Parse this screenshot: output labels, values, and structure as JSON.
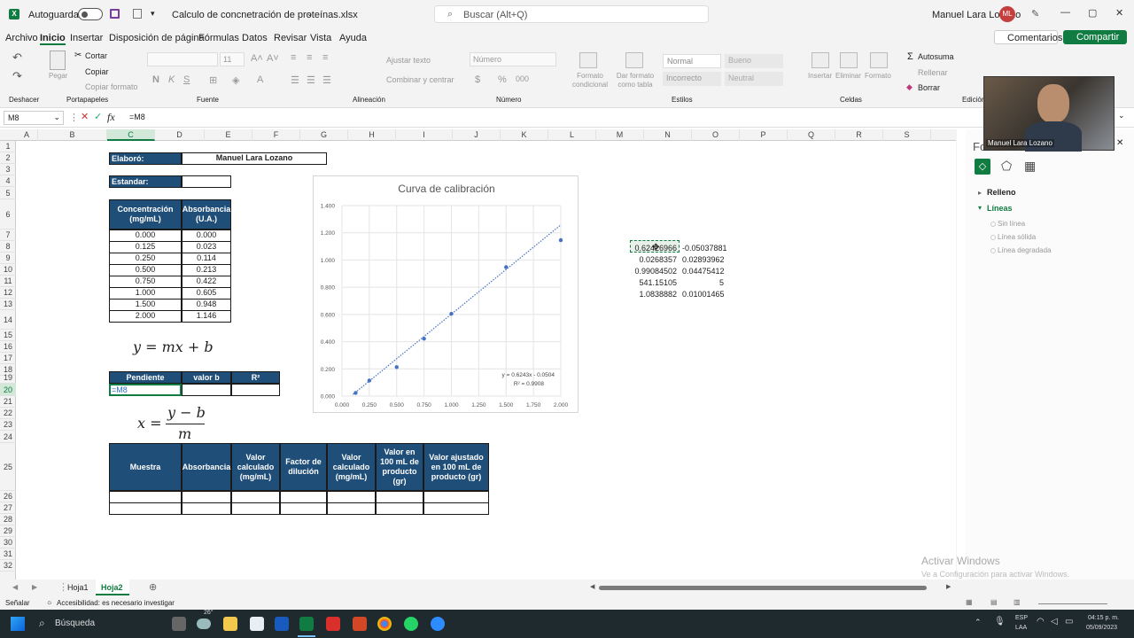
{
  "titlebar": {
    "autosave_label": "Autoguardado",
    "filename": "Calculo de concnetración de proteínas.xlsx",
    "search_placeholder": "Buscar (Alt+Q)",
    "user_name": "Manuel Lara Lozano",
    "user_initials": "ML"
  },
  "menu": {
    "items": [
      "Archivo",
      "Inicio",
      "Insertar",
      "Disposición de página",
      "Fórmulas",
      "Datos",
      "Revisar",
      "Vista",
      "Ayuda"
    ],
    "comments": "Comentarios",
    "share": "Compartir"
  },
  "ribbon": {
    "undo_group": "Deshacer",
    "clipboard": {
      "paste": "Pegar",
      "cut": "Cortar",
      "copy": "Copiar",
      "format_painter": "Copiar formato",
      "group": "Portapapeles"
    },
    "font": {
      "size": "11",
      "group": "Fuente"
    },
    "alignment": {
      "wrap": "Ajustar texto",
      "merge": "Combinar y centrar",
      "group": "Alineación"
    },
    "number": {
      "format": "Número",
      "group": "Número"
    },
    "styles": {
      "conditional": "Formato condicional",
      "as_table": "Dar formato como tabla",
      "normal": "Normal",
      "good": "Bueno",
      "bad": "Incorrecto",
      "neutral": "Neutral",
      "group": "Estilos"
    },
    "cells": {
      "insert": "Insertar",
      "delete": "Eliminar",
      "format": "Formato",
      "group": "Celdas"
    },
    "editing": {
      "autosum": "Autosuma",
      "fill": "Rellenar",
      "clear": "Borrar",
      "group": "Edición"
    }
  },
  "formula_bar": {
    "name_box": "M8",
    "fx": "fx",
    "formula": "=M8"
  },
  "columns": [
    "A",
    "B",
    "C",
    "D",
    "E",
    "F",
    "G",
    "H",
    "I",
    "J",
    "K",
    "L",
    "M",
    "N",
    "O",
    "P",
    "Q",
    "R",
    "S"
  ],
  "rows": [
    "1",
    "2",
    "3",
    "4",
    "5",
    "6",
    "7",
    "8",
    "9",
    "10",
    "11",
    "12",
    "13",
    "14",
    "15",
    "16",
    "17",
    "18",
    "19",
    "20",
    "21",
    "22",
    "23",
    "24",
    "25",
    "26",
    "27",
    "28",
    "29",
    "30",
    "31",
    "32"
  ],
  "sheet": {
    "elaboro_label": "Elaboró:",
    "elaboro_value": "Manuel Lara Lozano",
    "estandar_label": "Estandar:",
    "table_headers": {
      "conc": "Concentración (mg/mL)",
      "abs": "Absorbancia (U.A.)"
    },
    "table_rows": [
      [
        "0.000",
        "0.000"
      ],
      [
        "0.125",
        "0.023"
      ],
      [
        "0.250",
        "0.114"
      ],
      [
        "0.500",
        "0.213"
      ],
      [
        "0.750",
        "0.422"
      ],
      [
        "1.000",
        "0.605"
      ],
      [
        "1.500",
        "0.948"
      ],
      [
        "2.000",
        "1.146"
      ]
    ],
    "equation_line": "y = mx + b",
    "equation_x_lhs": "x =",
    "equation_x_num": "y − b",
    "equation_x_den": "m",
    "params_headers": [
      "Pendiente",
      "valor b",
      "R²"
    ],
    "active_cell_text": "=M8",
    "sample_headers": [
      "Muestra",
      "Absorbancia",
      "Valor calculado (mg/mL)",
      "Factor de dilución",
      "Valor calculado (mg/mL)",
      "Valor en 100 mL de producto (gr)",
      "Valor ajustado en 100 mL de producto (gr)"
    ],
    "linest": [
      [
        "0.62426966",
        "-0.05037881"
      ],
      [
        "0.0268357",
        "0.02893962"
      ],
      [
        "0.99084502",
        "0.04475412"
      ],
      [
        "541.15105",
        "5"
      ],
      [
        "1.0838882",
        "0.01001465"
      ]
    ]
  },
  "chart_data": {
    "type": "scatter",
    "title": "Curva de calibración",
    "x": [
      0.125,
      0.25,
      0.5,
      0.75,
      1.0,
      1.5,
      2.0
    ],
    "y": [
      0.023,
      0.114,
      0.213,
      0.422,
      0.605,
      0.948,
      1.146
    ],
    "xlim": [
      0,
      2
    ],
    "ylim": [
      0,
      1.4
    ],
    "xticks": [
      "0.000",
      "0.250",
      "0.500",
      "0.750",
      "1.000",
      "1.250",
      "1.500",
      "1.750",
      "2.000"
    ],
    "yticks": [
      "0.000",
      "0.200",
      "0.400",
      "0.600",
      "0.800",
      "1.000",
      "1.200",
      "1.400"
    ],
    "trendline": {
      "slope": 0.6243,
      "intercept": -0.0504,
      "equation": "y = 0.6243x - 0.0504",
      "r2": "R² = 0.9908"
    },
    "grid": true,
    "marker_color": "#4472c4"
  },
  "sidepane": {
    "title": "Fo",
    "fill": "Relleno",
    "lines": "Líneas",
    "options": [
      "Sin línea",
      "Línea sólida",
      "Línea degradada"
    ]
  },
  "webcam_name": "Manuel Lara Lozano",
  "sheet_tabs": [
    "Hoja1",
    "Hoja2"
  ],
  "status": {
    "ready": "Señalar",
    "accessibility": "Accesibilidad: es necesario investigar",
    "watermark1": "Activar Windows",
    "watermark2": "Ve a Configuración para activar Windows."
  },
  "taskbar": {
    "search": "Búsqueda",
    "weather": "26°",
    "lang1": "ESP",
    "lang2": "LAA",
    "time": "04:15 p. m.",
    "date": "05/09/2023"
  },
  "colors": {
    "excel_green": "#107c41",
    "header_blue": "#1f4e79",
    "marker": "#4472c4"
  }
}
